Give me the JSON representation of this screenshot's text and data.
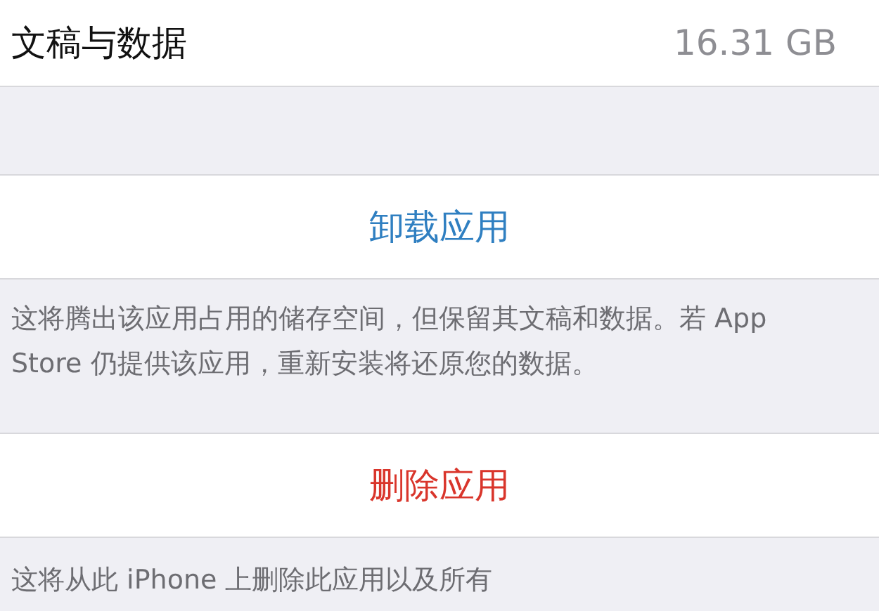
{
  "usage_row": {
    "label": "文稿与数据",
    "value": "16.31 GB"
  },
  "actions": [
    {
      "kind": "offload",
      "label": "卸载应用",
      "footer": "这将腾出该应用占用的储存空间，但保留其文稿和数据。若 App Store 仍提供该应用，重新安装将还原您的数据。"
    },
    {
      "kind": "delete",
      "label": "删除应用",
      "footer": "这将从此 iPhone 上删除此应用以及所有"
    }
  ]
}
